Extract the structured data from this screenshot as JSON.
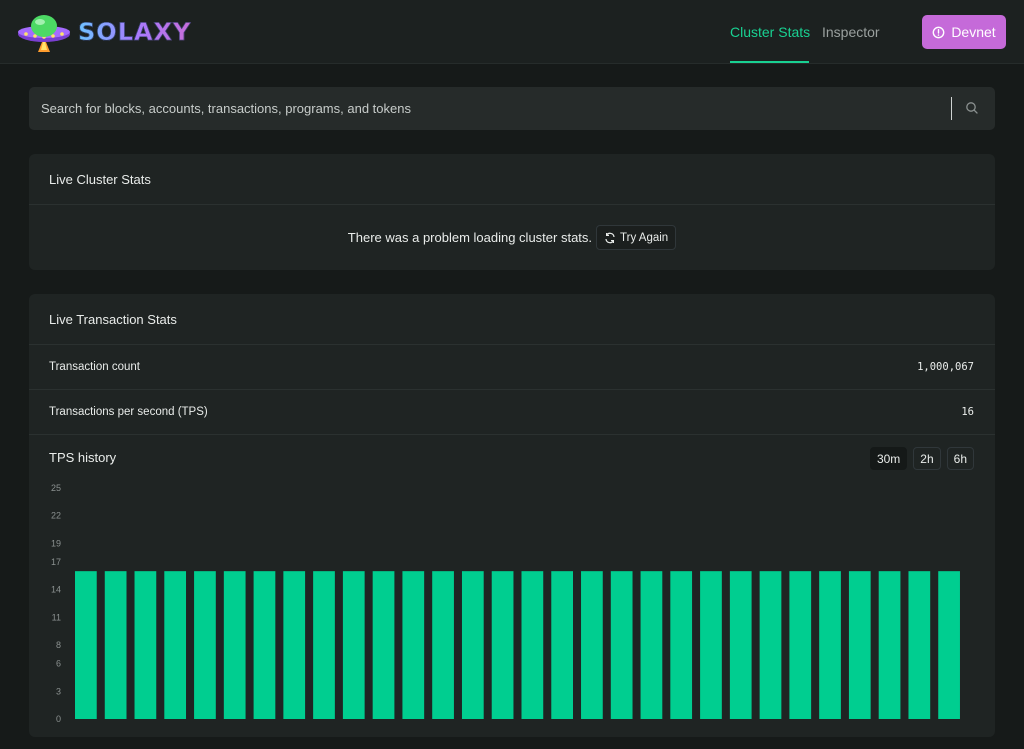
{
  "app": {
    "logo_text": "SOLAXY"
  },
  "nav": {
    "links": [
      {
        "label": "Cluster Stats",
        "active": true
      },
      {
        "label": "Inspector",
        "active": false
      }
    ],
    "cluster_button": "Devnet"
  },
  "search": {
    "placeholder": "Search for blocks, accounts, transactions, programs, and tokens"
  },
  "cluster_stats": {
    "title": "Live Cluster Stats",
    "error_text": "There was a problem loading cluster stats.",
    "retry_label": "Try Again"
  },
  "tx_stats": {
    "title": "Live Transaction Stats",
    "rows": [
      {
        "label": "Transaction count",
        "value": "1,000,067"
      },
      {
        "label": "Transactions per second (TPS)",
        "value": "16"
      }
    ],
    "history_title": "TPS history",
    "ranges": [
      {
        "label": "30m",
        "active": true
      },
      {
        "label": "2h",
        "active": false
      },
      {
        "label": "6h",
        "active": false
      }
    ]
  },
  "colors": {
    "accent": "#19d192",
    "devnet": "#c56ad9",
    "bar": "#00ce90"
  },
  "chart_data": {
    "type": "bar",
    "yticks": [
      "25",
      "22",
      "19",
      "17",
      "14",
      "11",
      "8",
      "6",
      "3",
      "0"
    ],
    "ylim": [
      0,
      25
    ],
    "values": [
      16,
      16,
      16,
      16,
      16,
      16,
      16,
      16,
      16,
      16,
      16,
      16,
      16,
      16,
      16,
      16,
      16,
      16,
      16,
      16,
      16,
      16,
      16,
      16,
      16,
      16,
      16,
      16,
      16,
      16
    ]
  }
}
